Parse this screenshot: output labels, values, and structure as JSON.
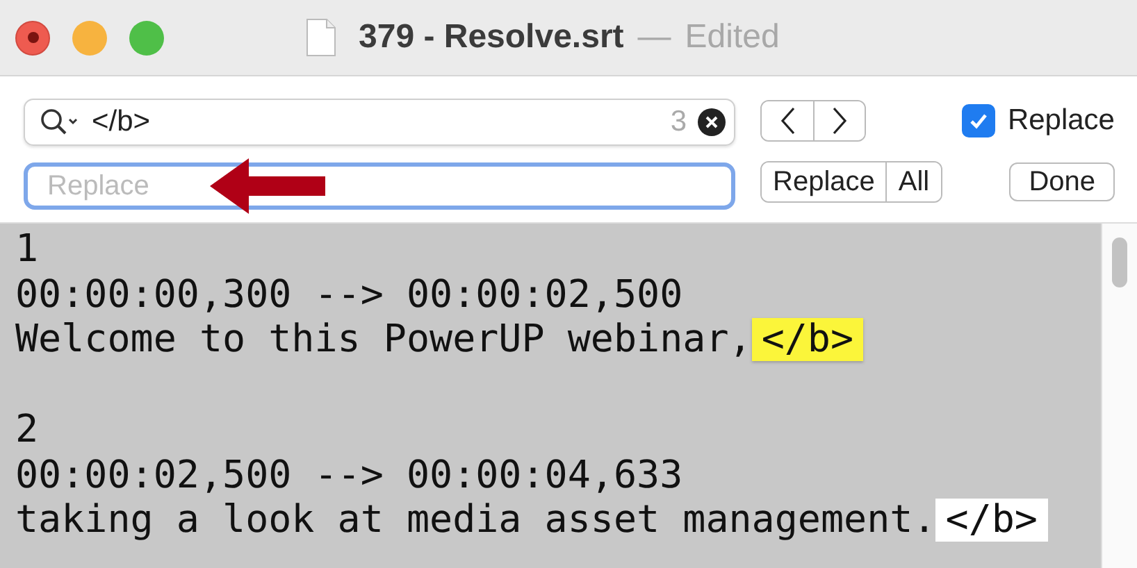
{
  "window": {
    "title": "379 - Resolve.srt",
    "separator": "—",
    "status": "Edited"
  },
  "find_bar": {
    "search_value": "</b>",
    "match_count": "3",
    "replace_placeholder": "Replace",
    "replace_enabled": true,
    "replace_toggle_label": "Replace",
    "buttons": [
      "Replace",
      "All",
      "Done"
    ]
  },
  "editor": {
    "blocks": [
      {
        "lines": [
          {
            "text": "1"
          },
          {
            "text": "00:00:00,300 --> 00:00:02,500"
          },
          {
            "text": "Welcome to this PowerUP webinar,",
            "match": {
              "text": "</b>",
              "current": true
            }
          }
        ]
      },
      {
        "lines": [
          {
            "text": "2"
          },
          {
            "text": "00:00:02,500 --> 00:00:04,633"
          },
          {
            "text": "taking a look at media asset management.",
            "match": {
              "text": "</b>",
              "current": false
            }
          }
        ]
      }
    ]
  }
}
